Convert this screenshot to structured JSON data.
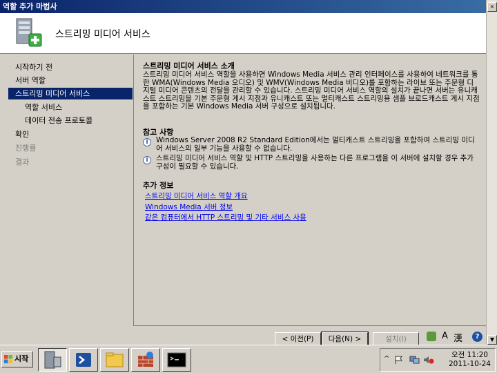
{
  "window": {
    "title": "역할 추가 마법사",
    "close_glyph": "×"
  },
  "header": {
    "title": "스트리밍 미디어 서비스"
  },
  "nav": [
    {
      "label": "시작하기 전",
      "state": "normal"
    },
    {
      "label": "서버 역할",
      "state": "normal"
    },
    {
      "label": "스트리밍 미디어 서비스",
      "state": "selected"
    },
    {
      "label": "역할 서비스",
      "state": "sub"
    },
    {
      "label": "데이터 전송 프로토콜",
      "state": "sub"
    },
    {
      "label": "확인",
      "state": "normal"
    },
    {
      "label": "진행률",
      "state": "disabled"
    },
    {
      "label": "결과",
      "state": "disabled"
    }
  ],
  "intro": {
    "heading": "스트리밍 미디어 서비스 소개",
    "text": "스트리밍 미디어 서비스 역할을 사용하면 Windows Media 서비스 관리 인터페이스를 사용하여 네트워크를 통한 WMA(Windows Media 오디오) 및 WMV(Windows Media 비디오)를 포함하는 라이브 또는 주문형 디지털 미디어 콘텐츠의 전달을 관리할 수 있습니다. 스트리밍 미디어 서비스 역할의 설치가 끝나면 서버는 유니캐스트 스트리밍을 기본 주문형 게시 지점과 유니캐스트 또는 멀티캐스트 스트리밍용 샘플 브로드캐스트 게시 지점을 포함하는 기본 Windows Media 서버 구성으로 설치됩니다."
  },
  "notes": {
    "heading": "참고 사항",
    "items": [
      "Windows Server 2008 R2 Standard Edition에서는 멀티캐스트 스트리밍을 포함하여 스트리밍 미디어 서비스의 일부 기능을 사용할 수 없습니다.",
      "스트리밍 미디어 서비스 역할 및 HTTP 스트리밍을 사용하는 다른 프로그램을 이 서버에 설치할 경우 추가 구성이 필요할 수 있습니다."
    ]
  },
  "more_info": {
    "heading": "추가 정보",
    "links": [
      "스트리밍 미디어 서비스 역할 개요",
      "Windows Media 서버 정보",
      "같은 컴퓨터에서 HTTP 스트리밍 및 기타 서비스 사용"
    ]
  },
  "buttons": {
    "prev": "< 이전(P)",
    "next": "다음(N) >",
    "install": "설치(I)"
  },
  "ime": {
    "a": "A",
    "han": "漢",
    "help": "?"
  },
  "taskbar": {
    "start_label": "시작",
    "time": "오전 11:20",
    "date": "2011-10-24"
  },
  "colors": {
    "selection": "#0a246a",
    "link": "#0000ee",
    "titlebar": "#0a246a"
  }
}
